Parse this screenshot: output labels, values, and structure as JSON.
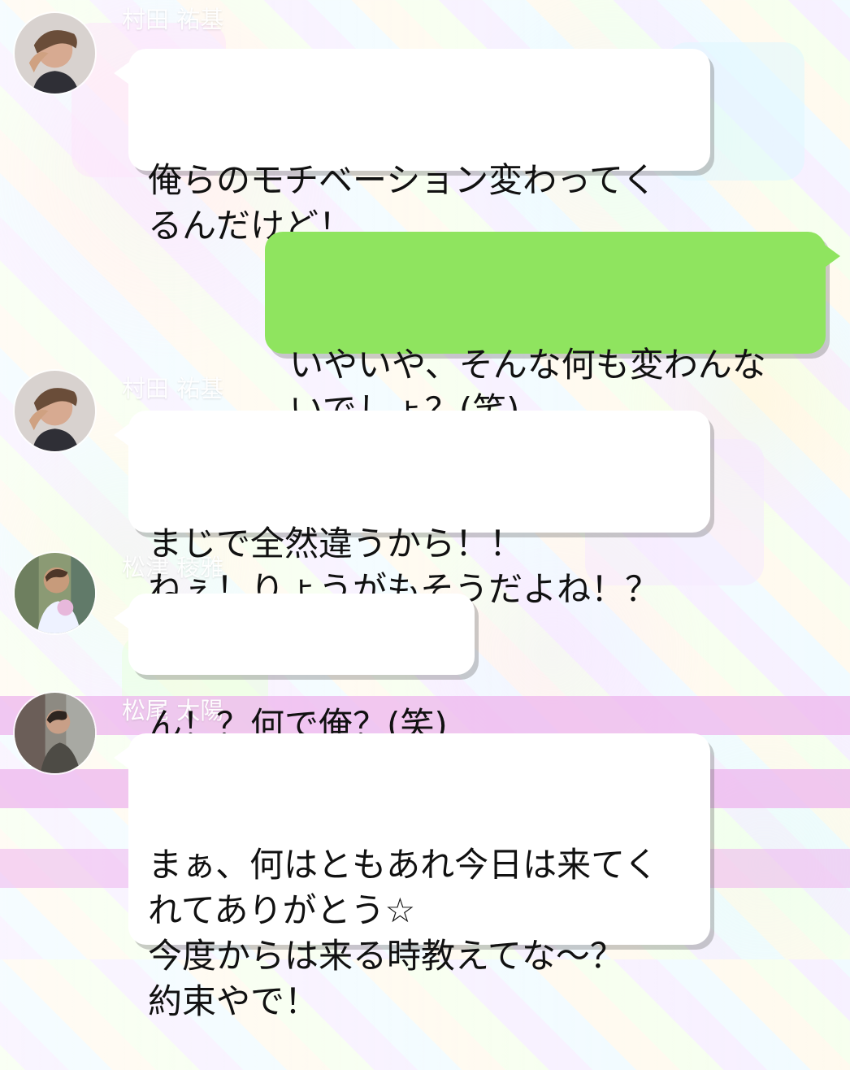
{
  "chat": {
    "messages": [
      {
        "sender": "村田 祐基",
        "avatar_icon": "profile-photo-icon",
        "text": "俺らのモチベーション変わってく\nるんだけど！"
      },
      {
        "sender": "",
        "direction": "outgoing",
        "text": "いやいや、そんな何も変わんな\nいでしょ？(笑)"
      },
      {
        "sender": "村田 祐基",
        "avatar_icon": "profile-photo-icon",
        "text": "まじで全然違うから！！\nねぇ！りょうがもそうだよね！？"
      },
      {
        "sender": "松津 稜雅",
        "avatar_icon": "profile-photo-icon",
        "text": "ん！？何で俺？(笑)"
      },
      {
        "sender": "松尾 太陽",
        "avatar_icon": "profile-photo-icon",
        "text": "まぁ、何はともあれ今日は来てく\nれてありがとう☆\n今度からは来る時教えてな〜？\n約束やで！"
      }
    ]
  },
  "colors": {
    "incoming_bubble": "#ffffff",
    "outgoing_bubble": "#8fe45f",
    "sender_name": "#ffffff",
    "accent_band": "#eeb5ee"
  }
}
